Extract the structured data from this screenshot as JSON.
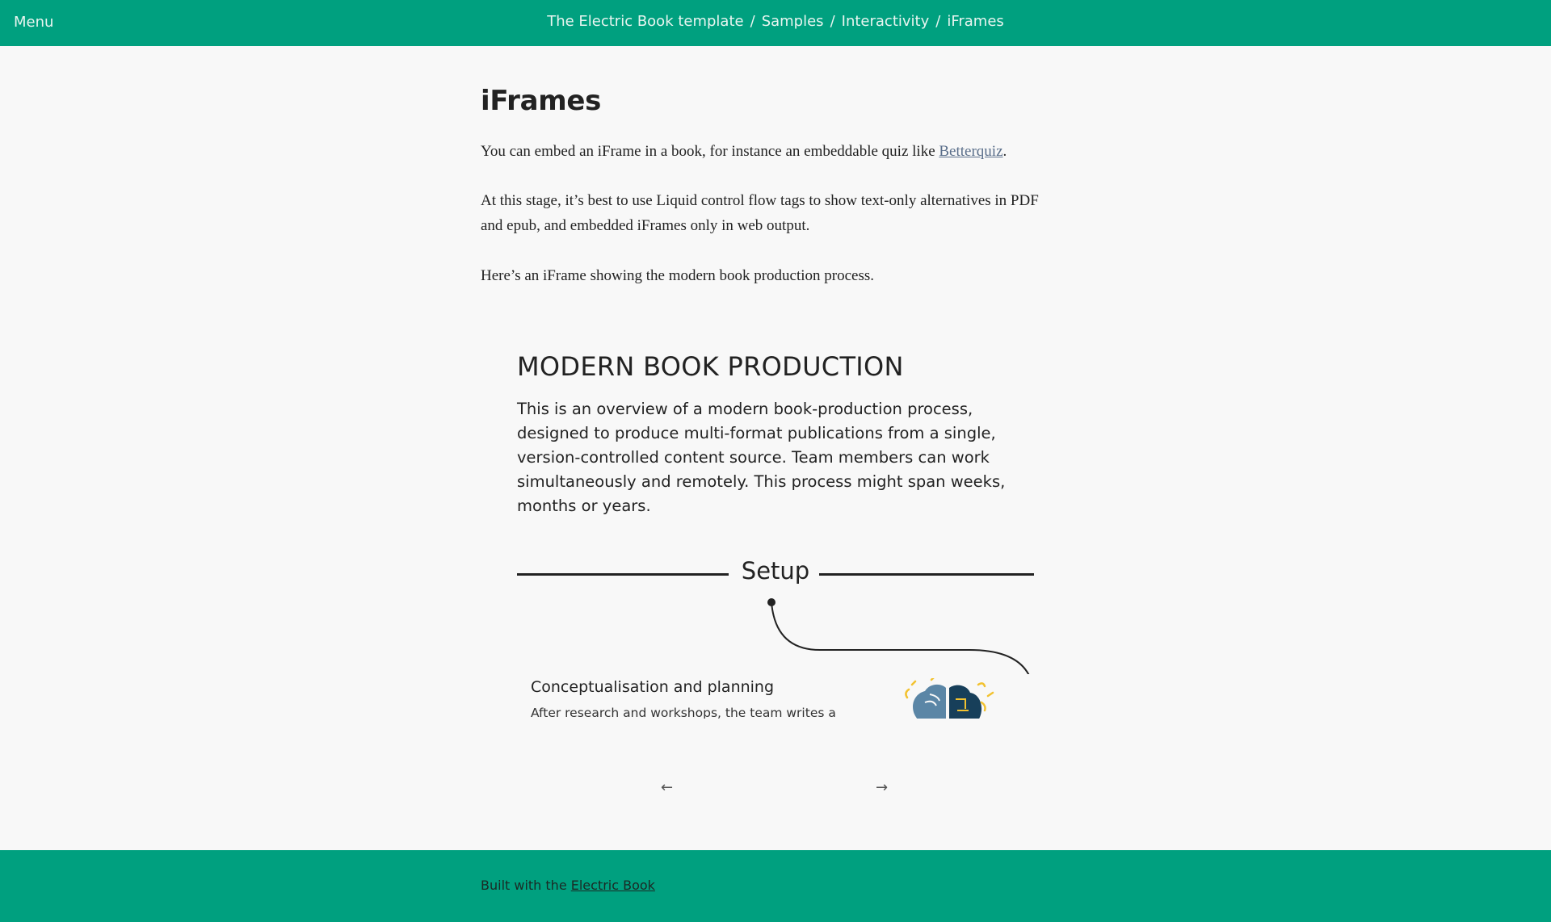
{
  "topbar": {
    "menu_label": "Menu",
    "breadcrumb": [
      "The Electric Book template",
      "Samples",
      "Interactivity",
      "iFrames"
    ],
    "separator": "/"
  },
  "main": {
    "title": "iFrames",
    "para1_before": "You can embed an iFrame in a book, for instance an embeddable quiz like ",
    "para1_link": "Betterquiz",
    "para1_after": ".",
    "para2": "At this stage, it’s best to use Liquid control flow tags to show text-only alternatives in PDF and epub, and embedded iFrames only in web output.",
    "para3": "Here’s an iFrame showing the modern book production process."
  },
  "iframe": {
    "heading": "MODERN BOOK PRODUCTION",
    "intro": "This is an overview of a modern book-production process, designed to produce multi-format publications from a single, version-controlled content source. Team members can work simultaneously and remotely. This process might span weeks, months or years.",
    "section_label": "Setup",
    "card_title": "Conceptualisation and planning",
    "card_text": "After research and workshops, the team writes a",
    "icon": "brain-icon"
  },
  "nav": {
    "prev": "←",
    "next": "→"
  },
  "footer": {
    "built_text": "Built with the ",
    "built_link": "Electric Book"
  },
  "colors": {
    "accent": "#00a07f",
    "background": "#f8f8f8",
    "brain_blue": "#5b86a6",
    "brain_dark": "#173f5a",
    "brain_yellow": "#f2c230"
  }
}
